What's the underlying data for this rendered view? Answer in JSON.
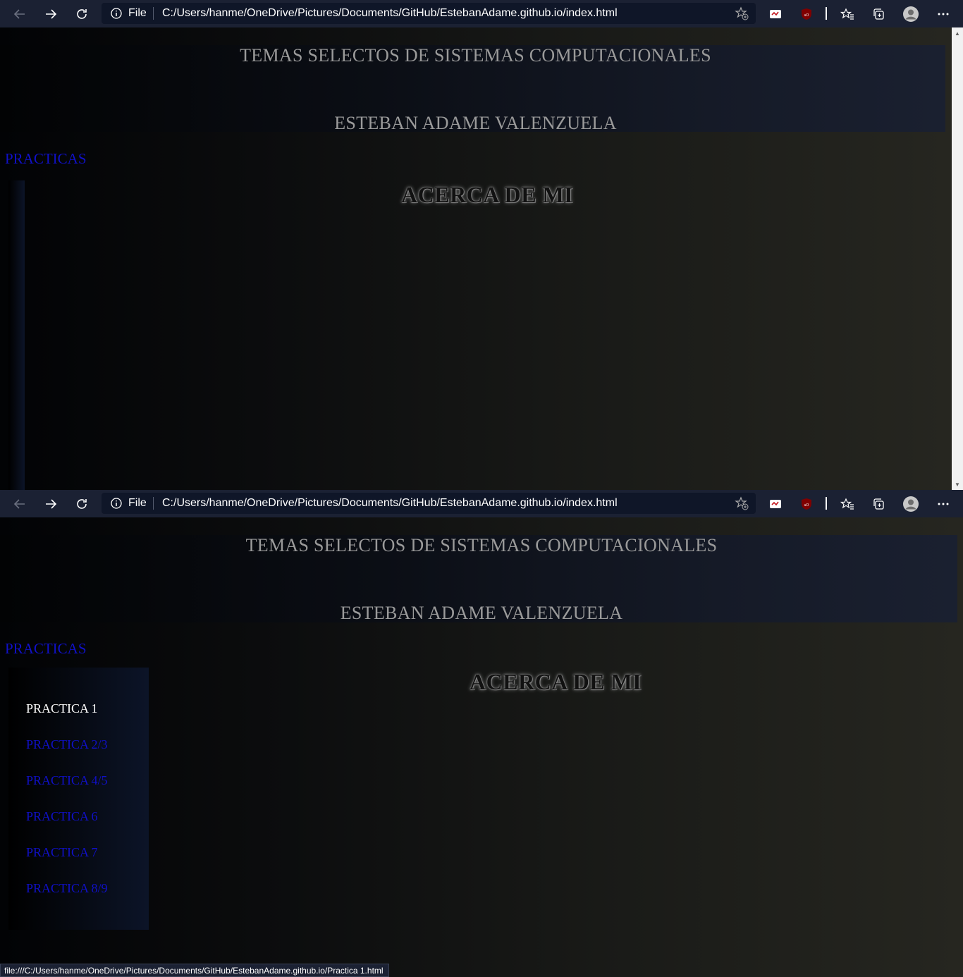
{
  "browser": {
    "file_label": "File",
    "url": "C:/Users/hanme/OneDrive/Pictures/Documents/GitHub/EstebanAdame.github.io/index.html"
  },
  "page": {
    "header_title": "TEMAS SELECTOS DE SISTEMAS COMPUTACIONALES",
    "header_name": "ESTEBAN ADAME VALENZUELA",
    "practicas_link": "PRACTICAS",
    "acerca": "ACERCA DE MI"
  },
  "menu": {
    "items": [
      {
        "label": "PRACTICA 1"
      },
      {
        "label": "PRACTICA 2/3"
      },
      {
        "label": "PRACTICA 4/5"
      },
      {
        "label": "PRACTICA 6"
      },
      {
        "label": "PRACTICA 7"
      },
      {
        "label": "PRACTICA 8/9"
      }
    ]
  },
  "status": {
    "hover_url": "file:///C:/Users/hanme/OneDrive/Pictures/Documents/GitHub/EstebanAdame.github.io/Practica 1.html"
  },
  "colors": {
    "link": "#1010c8",
    "header_text": "#9a9a9a",
    "toolbar": "#1b2133"
  }
}
